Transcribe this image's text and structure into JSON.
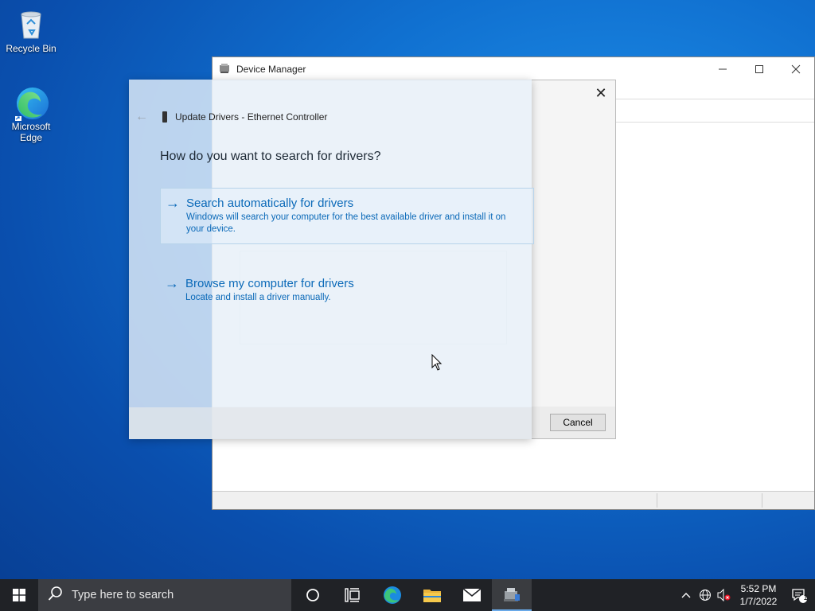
{
  "desktop": {
    "icons": [
      {
        "label": "Recycle Bin"
      },
      {
        "label": "Microsoft Edge"
      }
    ]
  },
  "device_manager": {
    "title": "Device Manager"
  },
  "properties_dialog": {
    "close_glyph": "✕",
    "cancel_label": "Cancel"
  },
  "update_drivers": {
    "header": "Update Drivers - Ethernet Controller",
    "question": "How do you want to search for drivers?",
    "options": [
      {
        "title": "Search automatically for drivers",
        "desc": "Windows will search your computer for the best available driver and install it on your device."
      },
      {
        "title": "Browse my computer for drivers",
        "desc": "Locate and install a driver manually."
      }
    ]
  },
  "taskbar": {
    "search_placeholder": "Type here to search",
    "time": "5:52 PM",
    "date": "1/7/2022",
    "notification_count": "1"
  }
}
